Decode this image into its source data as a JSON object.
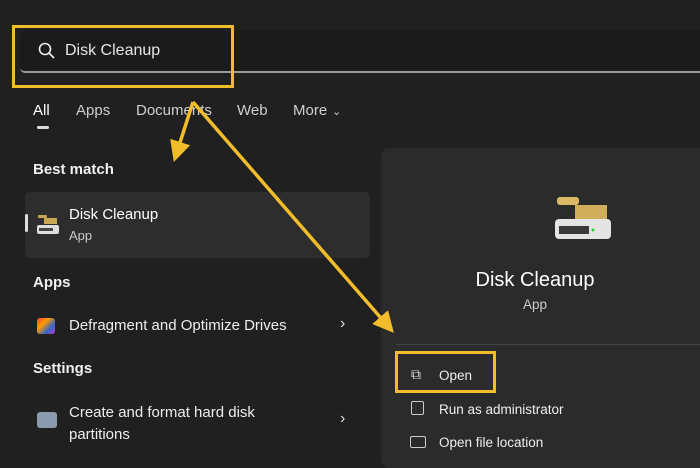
{
  "search": {
    "value": "Disk Cleanup"
  },
  "tabs": [
    "All",
    "Apps",
    "Documents",
    "Web",
    "More"
  ],
  "best_match": {
    "heading": "Best match",
    "title": "Disk Cleanup",
    "subtitle": "App"
  },
  "apps": {
    "heading": "Apps",
    "items": [
      {
        "label": "Defragment and Optimize Drives"
      }
    ]
  },
  "settings": {
    "heading": "Settings",
    "items": [
      {
        "line1": "Create and format hard disk",
        "line2": "partitions"
      }
    ]
  },
  "detail": {
    "title": "Disk Cleanup",
    "subtitle": "App",
    "actions": [
      "Open",
      "Run as administrator",
      "Open file location"
    ]
  },
  "colors": {
    "highlight": "#f2bd2a"
  }
}
